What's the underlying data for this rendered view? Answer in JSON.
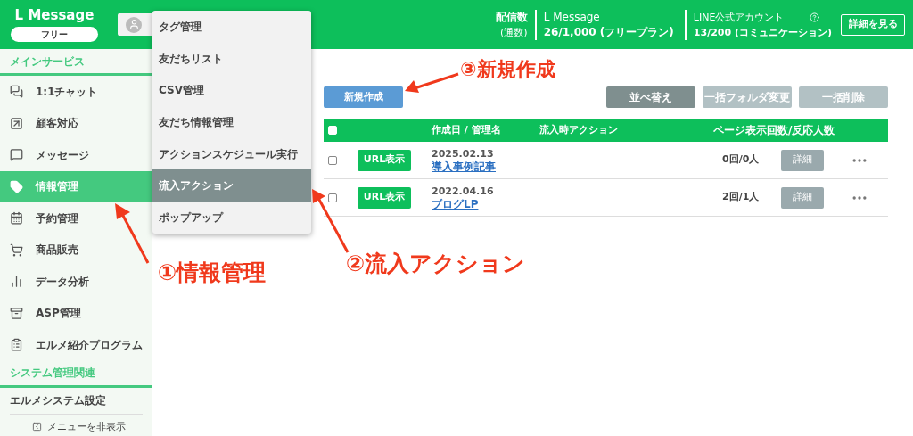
{
  "header": {
    "logo": "L Message",
    "plan_badge": "フリー",
    "stats_label": "配信数",
    "stats_sublabel": "(通数)",
    "lmessage": {
      "label": "L Message",
      "value": "26/1,000 (フリープラン)"
    },
    "line": {
      "label": "LINE公式アカウント",
      "value": "13/200 (コミュニケーション)"
    },
    "details_button": "詳細を見る"
  },
  "sidebar": {
    "sections": [
      {
        "title": "メインサービス",
        "items": [
          {
            "label": "1:1チャット",
            "selected": false
          },
          {
            "label": "顧客対応",
            "selected": false
          },
          {
            "label": "メッセージ",
            "selected": false
          },
          {
            "label": "情報管理",
            "selected": true
          },
          {
            "label": "予約管理",
            "selected": false
          },
          {
            "label": "商品販売",
            "selected": false
          },
          {
            "label": "データ分析",
            "selected": false
          },
          {
            "label": "ASP管理",
            "selected": false
          },
          {
            "label": "エルメ紹介プログラム",
            "selected": false
          }
        ]
      },
      {
        "title": "システム管理関連"
      }
    ],
    "settings": "エルメシステム設定",
    "hide_menu": "メニューを非表示"
  },
  "dropdown": [
    {
      "label": "タグ管理",
      "selected": false
    },
    {
      "label": "友だちリスト",
      "selected": false
    },
    {
      "label": "CSV管理",
      "selected": false
    },
    {
      "label": "友だち情報管理",
      "selected": false
    },
    {
      "label": "アクションスケジュール実行",
      "selected": false
    },
    {
      "label": "流入アクション",
      "selected": true
    },
    {
      "label": "ポップアップ",
      "selected": false
    }
  ],
  "toolbar": {
    "new_button": "新規作成",
    "buttons": [
      {
        "label": "並べ替え",
        "disabled": false
      },
      {
        "label": "一括フォルダ変更",
        "disabled": true
      },
      {
        "label": "一括削除",
        "disabled": true
      }
    ]
  },
  "table": {
    "header_checked": false,
    "columns": [
      "作成日 / 管理名",
      "流入時アクション",
      "ページ表示回数/反応人数"
    ],
    "rows": [
      {
        "checked": false,
        "url_button": "URL表示",
        "date": "2025.02.13",
        "name": "導入事例記事",
        "count": "0回/0人",
        "detail_button": "詳細"
      },
      {
        "checked": false,
        "url_button": "URL表示",
        "date": "2022.04.16",
        "name": "ブログLP",
        "count": "2回/1人",
        "detail_button": "詳細"
      }
    ]
  },
  "annotations": [
    {
      "text": "③新規作成"
    },
    {
      "text": "①情報管理"
    },
    {
      "text": "②流入アクション"
    }
  ]
}
